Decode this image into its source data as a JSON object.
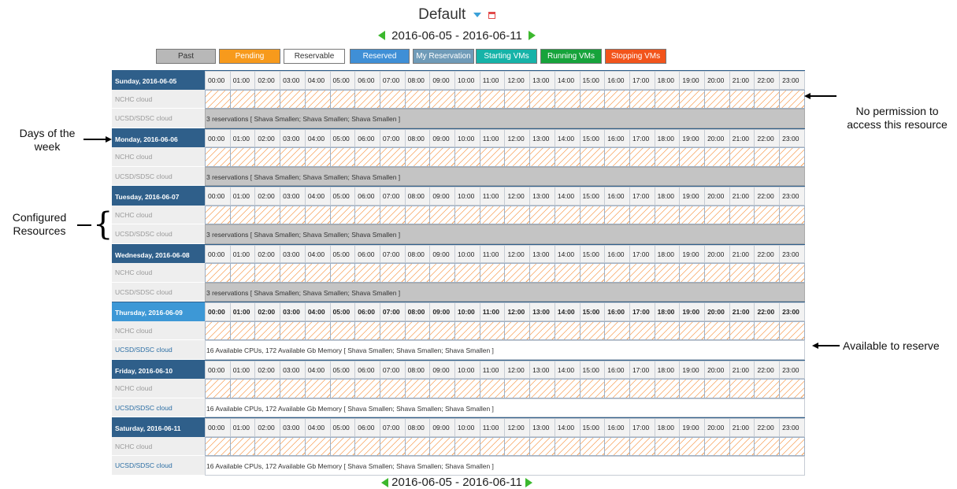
{
  "header": {
    "title": "Default",
    "week_range": "2016-06-05 - 2016-06-11"
  },
  "legend": [
    {
      "label": "Past",
      "bg": "#b8b8b8",
      "fg": "#333333"
    },
    {
      "label": "Pending",
      "bg": "#f79a1c",
      "fg": "#ffffff"
    },
    {
      "label": "Reservable",
      "bg": "#ffffff",
      "fg": "#333333"
    },
    {
      "label": "Reserved",
      "bg": "#3f8fd6",
      "fg": "#ffffff"
    },
    {
      "label": "My Reservation",
      "bg": "#6f9bb8",
      "fg": "#ffffff"
    },
    {
      "label": "Starting VMs",
      "bg": "#16b3a8",
      "fg": "#ffffff"
    },
    {
      "label": "Running VMs",
      "bg": "#16a33b",
      "fg": "#ffffff"
    },
    {
      "label": "Stopping VMs",
      "bg": "#f2541b",
      "fg": "#ffffff"
    }
  ],
  "hours": [
    "00:00",
    "01:00",
    "02:00",
    "03:00",
    "04:00",
    "05:00",
    "06:00",
    "07:00",
    "08:00",
    "09:00",
    "10:00",
    "11:00",
    "12:00",
    "13:00",
    "14:00",
    "15:00",
    "16:00",
    "17:00",
    "18:00",
    "19:00",
    "20:00",
    "21:00",
    "22:00",
    "23:00"
  ],
  "days": [
    {
      "label": "Sunday, 2016-06-05",
      "current": false,
      "resources": [
        {
          "name": "NCHC cloud",
          "state": "blocked"
        },
        {
          "name": "UCSD/SDSC cloud",
          "state": "busy",
          "text": "3 reservations [ Shava Smallen; Shava Smallen; Shava Smallen ]"
        }
      ]
    },
    {
      "label": "Monday, 2016-06-06",
      "current": false,
      "resources": [
        {
          "name": "NCHC cloud",
          "state": "blocked"
        },
        {
          "name": "UCSD/SDSC cloud",
          "state": "busy",
          "text": "3 reservations [ Shava Smallen; Shava Smallen; Shava Smallen ]"
        }
      ]
    },
    {
      "label": "Tuesday, 2016-06-07",
      "current": false,
      "resources": [
        {
          "name": "NCHC cloud",
          "state": "blocked"
        },
        {
          "name": "UCSD/SDSC cloud",
          "state": "busy",
          "text": "3 reservations [ Shava Smallen; Shava Smallen; Shava Smallen ]"
        }
      ]
    },
    {
      "label": "Wednesday, 2016-06-08",
      "current": false,
      "resources": [
        {
          "name": "NCHC cloud",
          "state": "blocked"
        },
        {
          "name": "UCSD/SDSC cloud",
          "state": "busy",
          "text": "3 reservations [ Shava Smallen; Shava Smallen; Shava Smallen ]"
        }
      ]
    },
    {
      "label": "Thursday, 2016-06-09",
      "current": true,
      "resources": [
        {
          "name": "NCHC cloud",
          "state": "blocked"
        },
        {
          "name": "UCSD/SDSC cloud",
          "state": "free",
          "text": "16 Available CPUs, 172 Available Gb Memory [ Shava Smallen; Shava Smallen; Shava Smallen ]"
        }
      ]
    },
    {
      "label": "Friday, 2016-06-10",
      "current": false,
      "resources": [
        {
          "name": "NCHC cloud",
          "state": "blocked"
        },
        {
          "name": "UCSD/SDSC cloud",
          "state": "free",
          "text": "16 Available CPUs, 172 Available Gb Memory [ Shava Smallen; Shava Smallen; Shava Smallen ]"
        }
      ]
    },
    {
      "label": "Saturday, 2016-06-11",
      "current": false,
      "resources": [
        {
          "name": "NCHC cloud",
          "state": "blocked"
        },
        {
          "name": "UCSD/SDSC cloud",
          "state": "free",
          "text": "16 Available CPUs, 172 Available Gb Memory [ Shava Smallen; Shava Smallen; Shava Smallen ]"
        }
      ]
    }
  ],
  "annotations": {
    "no_permission": "No permission to\naccess this resource",
    "days_of_week": "Days of the\nweek",
    "configured_resources": "Configured\nResources",
    "available": "Available to reserve"
  }
}
